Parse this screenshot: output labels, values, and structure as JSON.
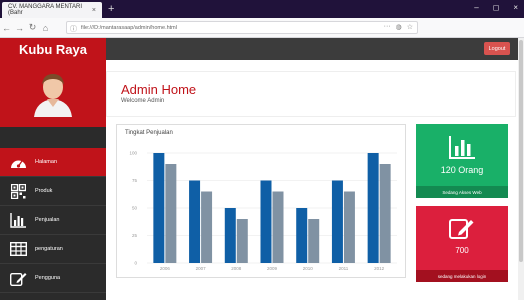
{
  "browser": {
    "tab_title": "CV. MANGGARA MENTARI (Bahr",
    "tab_close": "×",
    "new_tab": "+",
    "url": "file:///D:/mantarasaap/admin/home.html",
    "win_min": "–",
    "win_max": "◻",
    "win_close": "×"
  },
  "sidebar": {
    "brand": "Kubu Raya",
    "items": [
      {
        "label": "Halaman",
        "icon": "dashboard-icon",
        "active": true
      },
      {
        "label": "Produk",
        "icon": "qrcode-icon",
        "active": false
      },
      {
        "label": "Penjualan",
        "icon": "bar-chart-icon",
        "active": false
      },
      {
        "label": "pengaturan",
        "icon": "table-icon",
        "active": false
      },
      {
        "label": "Pengguna",
        "icon": "edit-icon",
        "active": false
      }
    ]
  },
  "topbar": {
    "logout_label": "Logout"
  },
  "header": {
    "title": "Admin Home",
    "subtitle": "Welcome Admin"
  },
  "chart_data": {
    "type": "bar",
    "title": "Tingkat Penjualan",
    "categories": [
      "2006",
      "2007",
      "2008",
      "2009",
      "2010",
      "2011",
      "2012"
    ],
    "series": [
      {
        "values": [
          100,
          75,
          50,
          75,
          50,
          75,
          100
        ]
      },
      {
        "values": [
          90,
          65,
          40,
          65,
          40,
          65,
          90
        ]
      }
    ],
    "yticks": [
      0,
      25,
      50,
      75,
      100
    ],
    "ylim": [
      0,
      100
    ],
    "colors": [
      "#0f5fa6",
      "#8092a3"
    ],
    "grid": true
  },
  "cards": {
    "orders": {
      "value": "120 Orang",
      "label": "Sedang Akses Web",
      "icon": "bar-chart-icon",
      "color": "#19b068"
    },
    "messages": {
      "value": "700",
      "label": "sedang melakukan login",
      "icon": "edit-icon",
      "color": "#dc1f3d"
    }
  },
  "colors": {
    "accent": "#c0131a",
    "sidebar": "#2b2b2b",
    "topbar": "#3c3c3c"
  }
}
